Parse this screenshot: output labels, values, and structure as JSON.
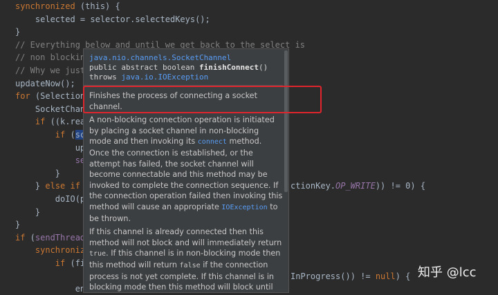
{
  "editor": {
    "lines": [
      {
        "parts": [
          {
            "t": "synchronized",
            "c": "kw"
          },
          {
            "t": " (this) {",
            "c": ""
          }
        ]
      },
      {
        "parts": [
          {
            "t": "    selected = selector.selectedKeys();",
            "c": ""
          }
        ]
      },
      {
        "parts": [
          {
            "t": "}",
            "c": ""
          }
        ]
      },
      {
        "parts": [
          {
            "t": "// Everything below and until we get back to the select is",
            "c": "cm"
          }
        ]
      },
      {
        "parts": [
          {
            "t": "// non blocking",
            "c": "cm"
          }
        ]
      },
      {
        "parts": [
          {
            "t": "// Why we just",
            "c": "cm"
          }
        ]
      },
      {
        "parts": [
          {
            "t": "updateNow();",
            "c": ""
          }
        ]
      },
      {
        "parts": [
          {
            "t": "for",
            "c": "kw"
          },
          {
            "t": " (SelectionK",
            "c": ""
          }
        ]
      },
      {
        "parts": [
          {
            "t": "    SocketChann",
            "c": ""
          }
        ]
      },
      {
        "parts": [
          {
            "t": "    ",
            "c": ""
          },
          {
            "t": "if",
            "c": "kw"
          },
          {
            "t": " ((k.read",
            "c": ""
          }
        ]
      },
      {
        "parts": [
          {
            "t": "        ",
            "c": ""
          },
          {
            "t": "if",
            "c": "kw"
          },
          {
            "t": " (",
            "c": ""
          },
          {
            "t": "sc.",
            "c": "sel"
          }
        ]
      },
      {
        "parts": [
          {
            "t": "            upd",
            "c": ""
          }
        ]
      },
      {
        "parts": [
          {
            "t": "            sen",
            "c": "fld"
          }
        ]
      },
      {
        "parts": [
          {
            "t": "        }",
            "c": ""
          }
        ]
      },
      {
        "parts": [
          {
            "t": "    } ",
            "c": ""
          },
          {
            "t": "else if",
            "c": "kw"
          },
          {
            "t": " (",
            "c": ""
          }
        ]
      },
      {
        "parts": [
          {
            "t": "        doIO(pe",
            "c": ""
          }
        ]
      },
      {
        "parts": [
          {
            "t": "    }",
            "c": ""
          }
        ]
      },
      {
        "parts": [
          {
            "t": "}",
            "c": ""
          }
        ]
      },
      {
        "parts": [
          {
            "t": "if",
            "c": "kw"
          },
          {
            "t": " (",
            "c": ""
          },
          {
            "t": "sendThread.",
            "c": "fld"
          }
        ]
      },
      {
        "parts": [
          {
            "t": "    ",
            "c": ""
          },
          {
            "t": "synchronize",
            "c": "kw"
          }
        ]
      },
      {
        "parts": [
          {
            "t": "        ",
            "c": ""
          },
          {
            "t": "if",
            "c": "kw"
          },
          {
            "t": " (fin",
            "c": ""
          }
        ]
      },
      {
        "parts": [
          {
            "t": "",
            "c": ""
          }
        ]
      },
      {
        "parts": [
          {
            "t": "            ena",
            "c": ""
          }
        ]
      }
    ],
    "right_fragments": [
      {
        "line": 14,
        "parts": [
          {
            "t": "ctionKey.",
            "c": ""
          },
          {
            "t": "OP_WRITE",
            "c": "fld it"
          },
          {
            "t": ")) != 0) {",
            "c": ""
          }
        ]
      },
      {
        "line": 21,
        "parts": [
          {
            "t": "InProgress()) != ",
            "c": ""
          },
          {
            "t": "null",
            "c": "kw"
          },
          {
            "t": ") {",
            "c": ""
          }
        ]
      }
    ]
  },
  "popup": {
    "class_link": "java.nio.channels.SocketChannel",
    "signature_prefix": "public abstract boolean ",
    "method_name": "finishConnect",
    "signature_suffix": "()",
    "throws_label": "throws ",
    "throws_link": "java.io.IOException",
    "summary": "Finishes the process of connecting a socket channel.",
    "para1_a": "A non-blocking connection operation is initiated by placing a socket channel in non-blocking mode and then invoking its ",
    "para1_code": "connect",
    "para1_b": " method. Once the connection is established, or the attempt has failed, the socket channel will become connectable and this method may be invoked to complete the connection sequence. If the connection operation failed then invoking this method will cause an appropriate ",
    "para1_code2": "IOException",
    "para1_c": " to be thrown.",
    "para2_a": "If this channel is already connected then this method will not block and will immediately return ",
    "para2_true": "true",
    "para2_b": ". If this channel is in non-blocking mode then this method will return ",
    "para2_false": "false",
    "para2_c": " if the connection process is not yet complete. If this channel is in blocking mode then this method will block until the connection either completes or fails, and will"
  },
  "watermark": "知乎 @lcc",
  "colors": {
    "highlight_box": "#e1252d",
    "background": "#2b2b2b",
    "popup_bg": "#3c3f41",
    "link": "#589df6"
  }
}
